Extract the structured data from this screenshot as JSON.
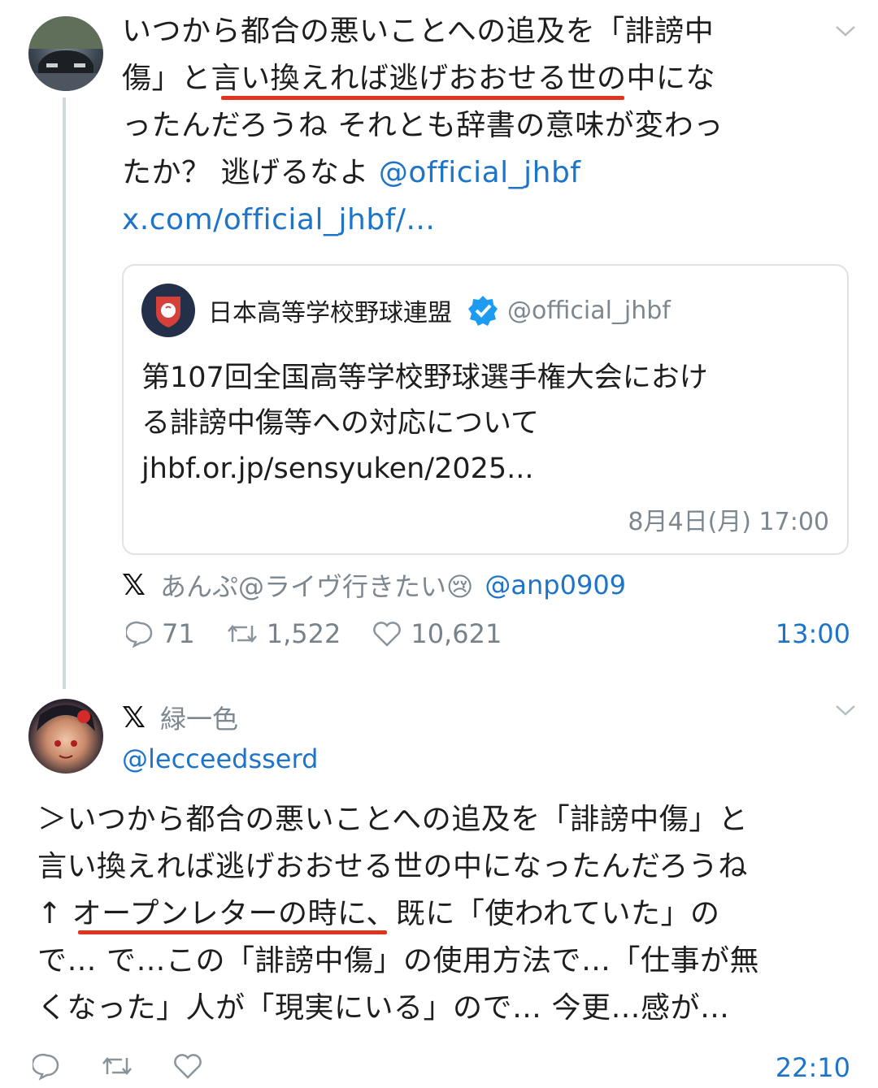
{
  "tweet1": {
    "text_lines": [
      "いつから都合の悪いことへの追及を「誹謗中",
      "傷」と言い換えれば逃げおおせる世の中にな",
      "ったんだろうね それとも辞書の意味が変わっ"
    ],
    "line4_text": "たか？ 逃げるなよ",
    "mention": "@official_jhbf",
    "link": "x.com/official_jhbf/...",
    "quote": {
      "org_name": "日本高等学校野球連盟",
      "handle": "@official_jhbf",
      "text_lines": [
        "第107回全国高等学校野球選手権大会におけ",
        "る誹謗中傷等への対応について"
      ],
      "link": "jhbf.or.jp/sensyuken/2025...",
      "timestamp": "8月4日(月) 17:00"
    },
    "author_display": "あんぷ@ライヴ行きたい😢",
    "author_handle": "@anp0909",
    "replies": "71",
    "retweets": "1,522",
    "likes": "10,621",
    "time": "13:00"
  },
  "tweet2": {
    "display_name": "緑一色",
    "handle": "@lecceedsserd",
    "text_lines": [
      "＞いつから都合の悪いことへの追及を「誹謗中傷」と",
      "言い換えれば逃げおおせる世の中になったんだろうね",
      "↑ オープンレターの時に、既に「使われていた」の",
      "で… で…この「誹謗中傷」の使用方法で…「仕事が無",
      "くなった」人が「現実にいる」ので… 今更…感が…"
    ],
    "time": "22:10"
  },
  "colors": {
    "accent_link": "#1d74c9",
    "highlight_underline": "#e0341f",
    "verified_badge": "#1d9bf0"
  }
}
